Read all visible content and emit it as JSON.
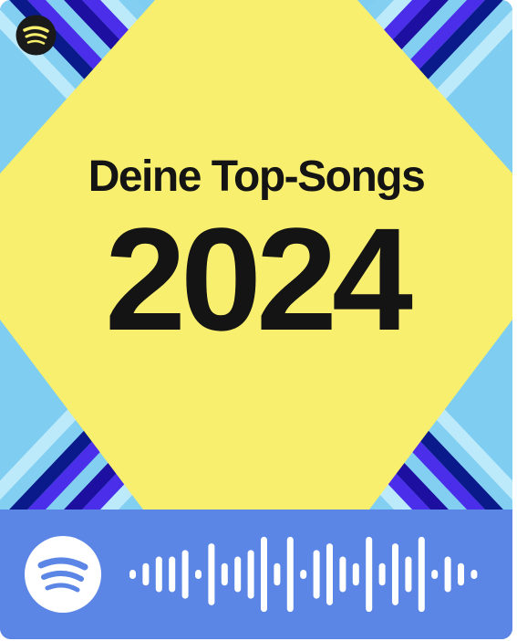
{
  "cover": {
    "title": "Deine Top-Songs",
    "year": "2024",
    "background_color": "#f9ef6e",
    "stripe_colors": [
      "#4a2eea",
      "#1d0fa0",
      "#83cff2",
      "#bdeafa",
      "#0a1a8a"
    ],
    "brand_icon": "spotify-icon"
  },
  "spotify_code": {
    "background_color": "#5b86e5",
    "bar_color": "#ffffff",
    "logo_icon": "spotify-icon",
    "bar_levels": [
      1,
      2,
      3,
      3,
      4,
      1,
      5,
      2,
      3,
      4,
      6,
      2,
      6,
      1,
      4,
      5,
      3,
      2,
      6,
      2,
      5,
      3,
      6,
      1,
      3,
      2,
      1
    ]
  }
}
